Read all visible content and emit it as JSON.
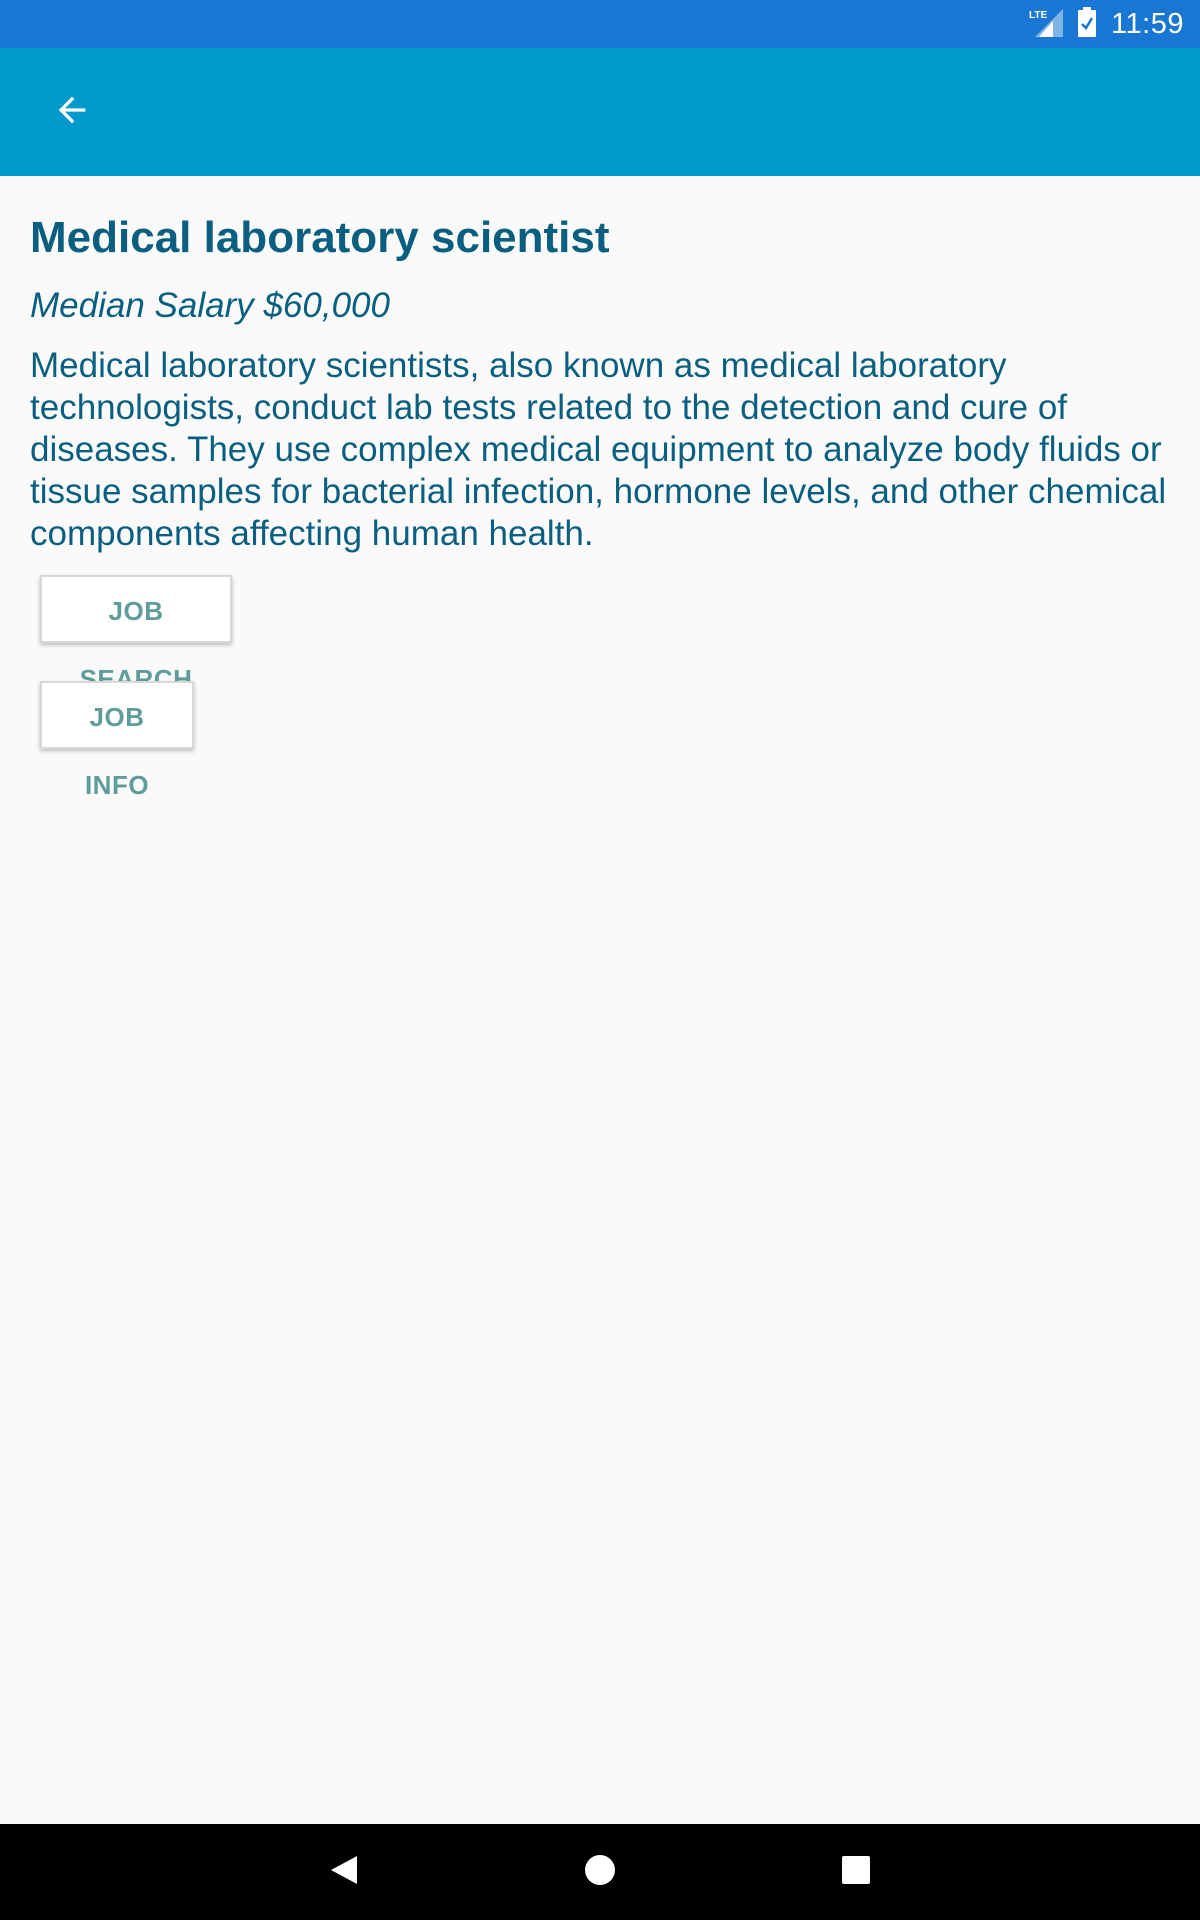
{
  "status_bar": {
    "network": "LTE",
    "time": "11:59",
    "icons": [
      "lte-signal-icon",
      "battery-icon"
    ]
  },
  "app_bar": {
    "back_icon": "arrow-back-icon"
  },
  "job": {
    "title": "Medical laboratory scientist",
    "salary": "Median Salary  $60,000",
    "description": "Medical laboratory scientists, also known as medical laboratory technologists, conduct lab tests related to the detection and cure of diseases. They use complex medical equipment to analyze body fluids or tissue samples for bacterial infection, hormone levels, and other chemical components affecting human health."
  },
  "buttons": {
    "job_search": "JOB SEARCH",
    "job_info": "JOB INFO"
  },
  "nav_bar": {
    "icons": [
      "nav-back-icon",
      "nav-home-icon",
      "nav-recents-icon"
    ]
  },
  "colors": {
    "status_bar": "#1976d2",
    "app_bar": "#0099cc",
    "text": "#0a5f80",
    "button_text": "#5f9c9a",
    "background": "#fafafa"
  }
}
